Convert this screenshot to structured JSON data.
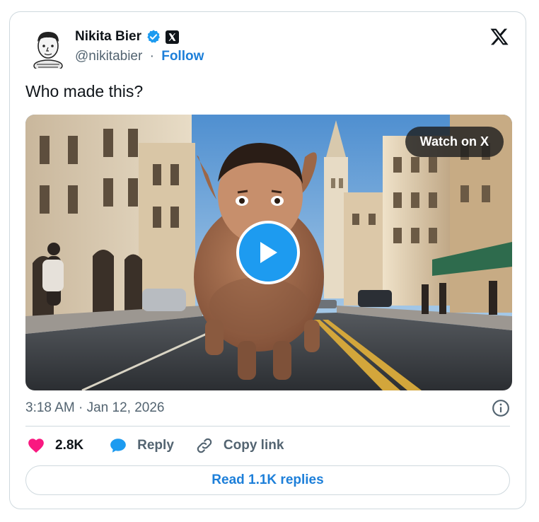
{
  "author": {
    "name": "Nikita Bier",
    "handle": "@nikitabier",
    "separator": "·",
    "follow_label": "Follow"
  },
  "tweet": {
    "text": "Who made this?",
    "timestamp": "3:18 AM · Jan 12, 2026"
  },
  "media": {
    "watch_label": "Watch on X",
    "sky_color": "#6fa3d6",
    "road_color": "#3b3f44",
    "pig_color": "#a06a4a"
  },
  "actions": {
    "like_count": "2.8K",
    "reply_label": "Reply",
    "copy_label": "Copy link"
  },
  "footer": {
    "read_replies_label": "Read 1.1K replies"
  },
  "icons": {
    "avatar": "cartoon-avatar-icon",
    "verified": "verified-badge-icon",
    "x_affiliate": "x-affiliate-badge-icon",
    "x_logo": "x-logo-icon",
    "play": "play-icon",
    "info": "info-icon",
    "like": "heart-icon",
    "reply": "speech-bubble-icon",
    "copy": "link-icon"
  },
  "colors": {
    "accent": "#1d9bf0",
    "link": "#1d7fd9",
    "like": "#f91880",
    "muted": "#536471",
    "border": "#cfd9de"
  }
}
